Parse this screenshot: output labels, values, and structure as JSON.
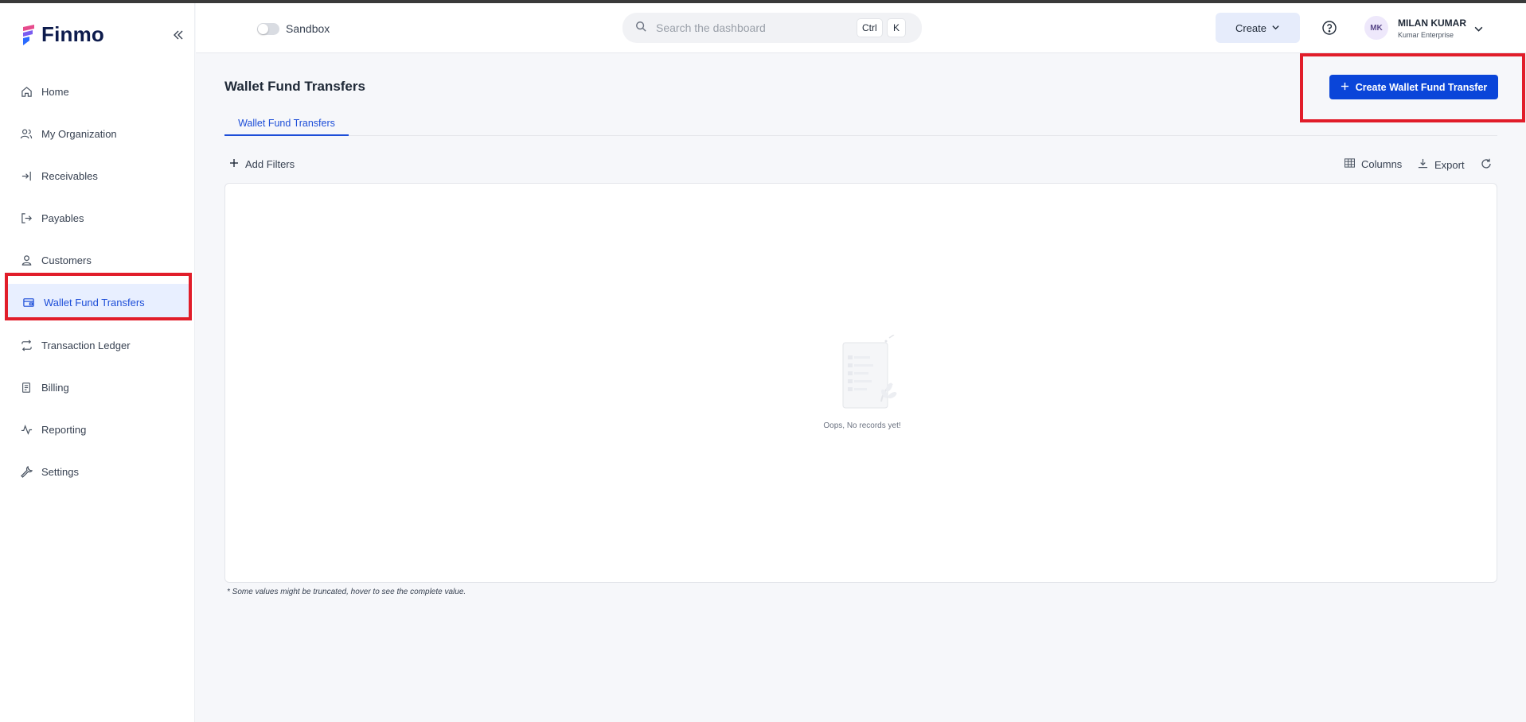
{
  "app": {
    "logo_text": "Finmo"
  },
  "sidebar": {
    "items": [
      {
        "label": "Home",
        "icon": "home-icon"
      },
      {
        "label": "My Organization",
        "icon": "users-icon"
      },
      {
        "label": "Receivables",
        "icon": "login-arrow-icon"
      },
      {
        "label": "Payables",
        "icon": "logout-arrow-icon"
      },
      {
        "label": "Customers",
        "icon": "user-icon"
      },
      {
        "label": "Wallet Fund Transfers",
        "icon": "wallet-icon",
        "active": true
      },
      {
        "label": "Transaction Ledger",
        "icon": "repeat-icon"
      },
      {
        "label": "Billing",
        "icon": "receipt-icon"
      },
      {
        "label": "Reporting",
        "icon": "activity-icon"
      },
      {
        "label": "Settings",
        "icon": "wrench-icon"
      }
    ]
  },
  "header": {
    "sandbox_label": "Sandbox",
    "search_placeholder": "Search the dashboard",
    "kbd_ctrl": "Ctrl",
    "kbd_k": "K",
    "create_label": "Create",
    "user_initials": "MK",
    "user_name": "MILAN KUMAR",
    "user_org": "Kumar Enterprise"
  },
  "main": {
    "title": "Wallet Fund Transfers",
    "primary_button": "Create Wallet Fund Transfer",
    "tabs": [
      {
        "label": "Wallet Fund Transfers",
        "active": true
      }
    ],
    "add_filters": "Add Filters",
    "columns": "Columns",
    "export": "Export",
    "empty_text": "Oops, No records yet!",
    "footnote": "* Some values might be truncated, hover to see the complete value."
  },
  "colors": {
    "primary": "#0a45d9",
    "active_nav_bg": "#e8efff",
    "highlight": "#e11d2a"
  }
}
